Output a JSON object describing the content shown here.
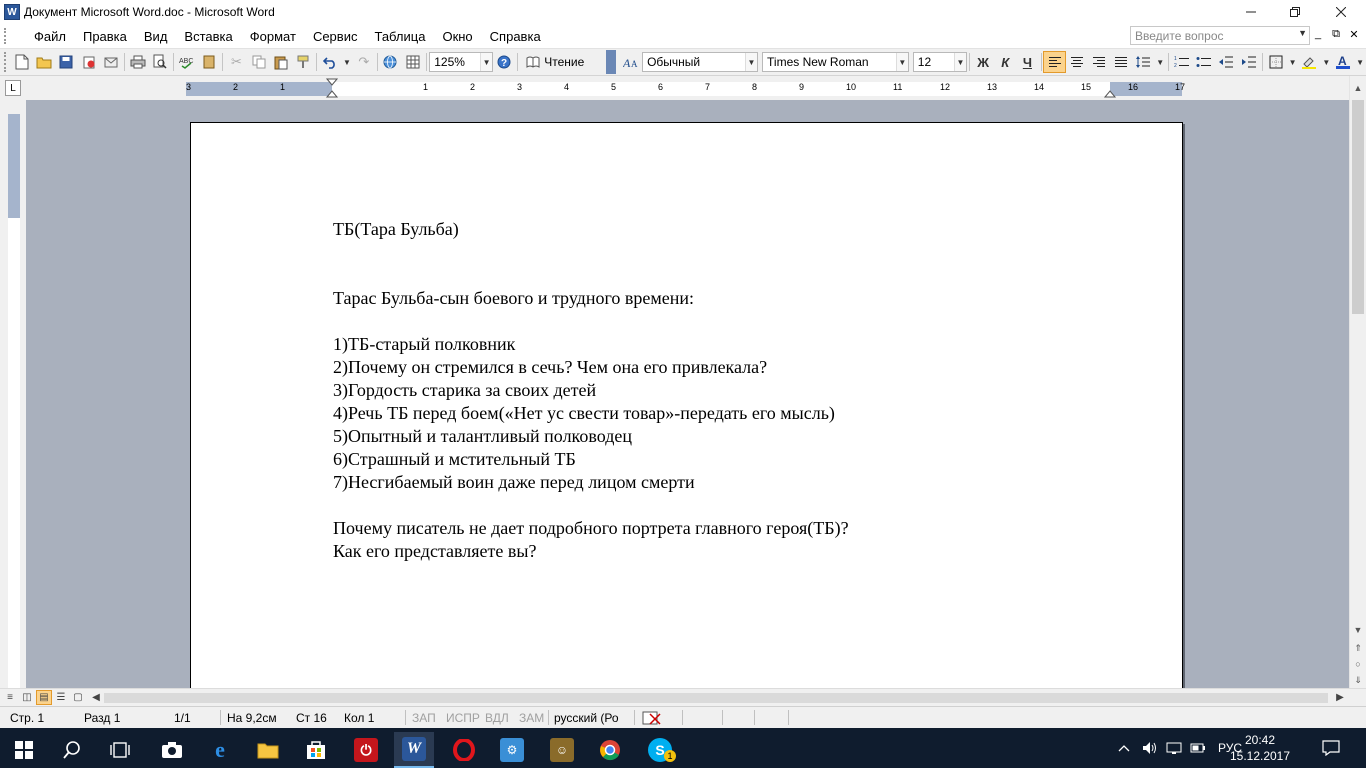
{
  "window": {
    "title": "Документ Microsoft Word.doc - Microsoft Word",
    "app_icon": "W",
    "controls": [
      "minimize-icon",
      "restore-icon",
      "close-icon"
    ]
  },
  "menu": {
    "items": [
      "Файл",
      "Правка",
      "Вид",
      "Вставка",
      "Формат",
      "Сервис",
      "Таблица",
      "Окно",
      "Справка"
    ],
    "ask_placeholder": "Введите вопрос",
    "doc_controls": [
      "_",
      "⧉",
      "✕"
    ]
  },
  "toolbar": {
    "zoom": "125%",
    "read_label": "Чтение",
    "style": "Обычный",
    "font": "Times New Roman",
    "size": "12",
    "bold": "Ж",
    "italic": "К",
    "underline": "Ч"
  },
  "ruler": {
    "labels": [
      "3",
      "2",
      "1",
      "1",
      "2",
      "3",
      "4",
      "5",
      "6",
      "7",
      "8",
      "9",
      "10",
      "11",
      "12",
      "13",
      "14",
      "15",
      "16",
      "17"
    ]
  },
  "document": {
    "lines": [
      "ТБ(Тара Бульба)",
      "",
      "",
      "Тарас Бульба-сын боевого и трудного времени:",
      "",
      "1)ТБ-старый полковник",
      "2)Почему он стремился в сечь? Чем она его привлекала?",
      "3)Гордость старика за своих детей",
      "4)Речь ТБ перед боем(«Нет ус свести товар»-передать его мысль)",
      "5)Опытный и талантливый полководец",
      "6)Страшный и мстительный ТБ",
      "7)Несгибаемый воин даже перед лицом смерти",
      "",
      "Почему писатель не дает подробного портрета главного героя(ТБ)?",
      "Как его представляете вы?"
    ]
  },
  "status": {
    "page": "Стр. 1",
    "section": "Разд 1",
    "pages": "1/1",
    "at": "На 9,2см",
    "line": "Ст 16",
    "col": "Кол 1",
    "rec": "ЗАП",
    "trk": "ИСПР",
    "ext": "ВДЛ",
    "ovr": "ЗАМ",
    "language": "русский (Ро"
  },
  "taskbar": {
    "lang": "РУС",
    "time": "20:42",
    "date": "15.12.2017",
    "skype_badge": "1"
  },
  "colors": {
    "word_blue": "#2b579a",
    "doc_background": "#a9b0bd",
    "taskbar": "#0f1c2e",
    "active_button": "#fbd38d"
  }
}
